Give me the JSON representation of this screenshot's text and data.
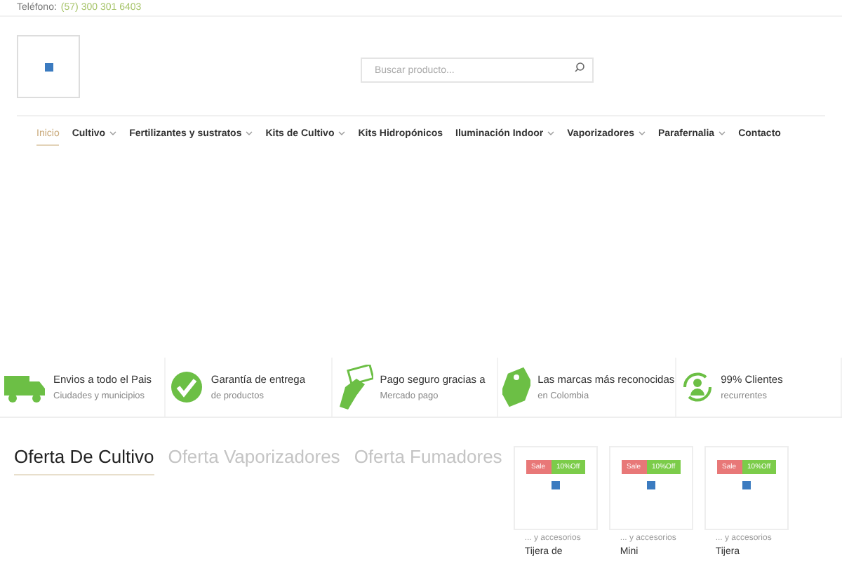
{
  "topbar": {
    "label": "Teléfono:",
    "phone": "(57) 300 301 6403"
  },
  "search": {
    "placeholder": "Buscar producto..."
  },
  "nav": [
    {
      "label": "Inicio",
      "selected": true,
      "dropdown": false
    },
    {
      "label": "Cultivo",
      "selected": false,
      "dropdown": true
    },
    {
      "label": "Fertilizantes y sustratos",
      "selected": false,
      "dropdown": true
    },
    {
      "label": "Kits de Cultivo",
      "selected": false,
      "dropdown": true
    },
    {
      "label": "Kits Hidropónicos",
      "selected": false,
      "dropdown": false
    },
    {
      "label": "Iluminación Indoor",
      "selected": false,
      "dropdown": true
    },
    {
      "label": "Vaporizadores",
      "selected": false,
      "dropdown": true
    },
    {
      "label": "Parafernalia",
      "selected": false,
      "dropdown": true
    },
    {
      "label": "Contacto",
      "selected": false,
      "dropdown": false
    }
  ],
  "features": [
    {
      "kind": "truck",
      "title": "Envios a todo el Pais",
      "subtitle": "Ciudades y municipios"
    },
    {
      "kind": "check",
      "title": "Garantía de entrega",
      "subtitle": "de productos"
    },
    {
      "kind": "card",
      "title": "Pago seguro gracias a",
      "subtitle": "Mercado pago"
    },
    {
      "kind": "tag",
      "title": "Las marcas más reconocidas",
      "subtitle": "en Colombia"
    },
    {
      "kind": "person",
      "title": "99% Clientes",
      "subtitle": "recurrentes"
    }
  ],
  "offer_tabs": [
    {
      "label": "Oferta De Cultivo",
      "selected": true
    },
    {
      "label": "Oferta Vaporizadores",
      "selected": false
    },
    {
      "label": "Oferta Fumadores",
      "selected": false
    }
  ],
  "products": [
    {
      "sale": "Sale",
      "discount": "10%Off",
      "category": "... y accesorios",
      "title": "Tijera de"
    },
    {
      "sale": "Sale",
      "discount": "10%Off",
      "category": "... y accesorios",
      "title": "Mini"
    },
    {
      "sale": "Sale",
      "discount": "10%Off",
      "category": "... y accesorios",
      "title": "Tijera"
    }
  ]
}
